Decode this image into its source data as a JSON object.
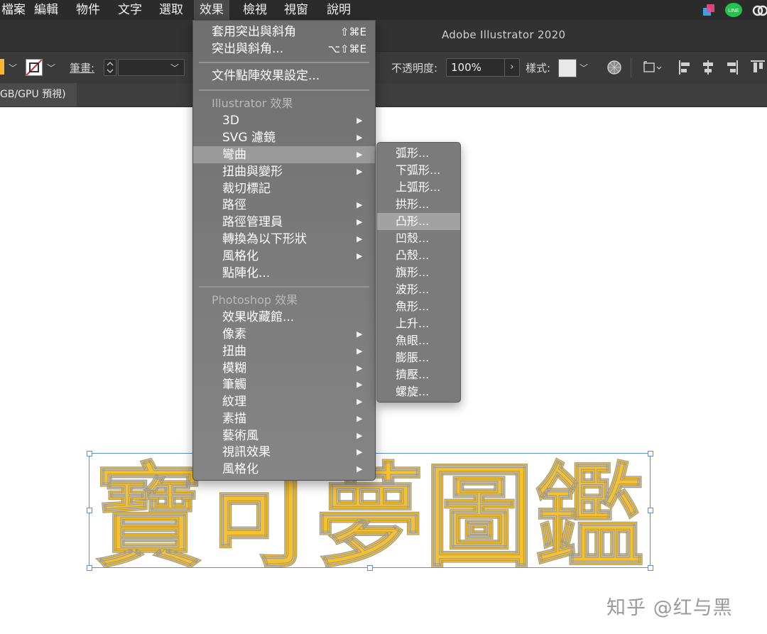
{
  "menubar": {
    "items": [
      "檔案",
      "編輯",
      "物件",
      "文字",
      "選取",
      "效果",
      "檢視",
      "視窗",
      "說明"
    ],
    "active": "效果"
  },
  "title": "Adobe Illustrator 2020",
  "controlbar": {
    "stroke_label": "筆畫:",
    "opacity_label": "不透明度:",
    "opacity_value": "100%",
    "style_label": "樣式:"
  },
  "tab": {
    "label": "GB/GPU 預視)"
  },
  "effect_menu": {
    "top_items": [
      {
        "label": "套用突出與斜角",
        "shortcut": "⇧⌘E"
      },
      {
        "label": "突出與斜角...",
        "shortcut": "⌥⇧⌘E"
      }
    ],
    "doc_raster": "文件點陣效果設定...",
    "illustrator_header": "Illustrator 效果",
    "illustrator_items": [
      {
        "label": "3D",
        "submenu": true
      },
      {
        "label": "SVG 濾鏡",
        "submenu": true
      },
      {
        "label": "彎曲",
        "submenu": true,
        "highlighted": true
      },
      {
        "label": "扭曲與變形",
        "submenu": true
      },
      {
        "label": "裁切標記",
        "submenu": false
      },
      {
        "label": "路徑",
        "submenu": true
      },
      {
        "label": "路徑管理員",
        "submenu": true
      },
      {
        "label": "轉換為以下形狀",
        "submenu": true
      },
      {
        "label": "風格化",
        "submenu": true
      },
      {
        "label": "點陣化...",
        "submenu": false
      }
    ],
    "photoshop_header": "Photoshop 效果",
    "photoshop_items": [
      {
        "label": "效果收藏館...",
        "submenu": false
      },
      {
        "label": "像素",
        "submenu": true
      },
      {
        "label": "扭曲",
        "submenu": true
      },
      {
        "label": "模糊",
        "submenu": true
      },
      {
        "label": "筆觸",
        "submenu": true
      },
      {
        "label": "紋理",
        "submenu": true
      },
      {
        "label": "素描",
        "submenu": true
      },
      {
        "label": "藝術風",
        "submenu": true
      },
      {
        "label": "視訊效果",
        "submenu": true
      },
      {
        "label": "風格化",
        "submenu": true
      }
    ]
  },
  "warp_menu": {
    "items": [
      "弧形...",
      "下弧形...",
      "上弧形...",
      "拱形...",
      "凸形...",
      "凹殼...",
      "凸殼...",
      "旗形...",
      "波形...",
      "魚形...",
      "上升...",
      "魚眼...",
      "膨脹...",
      "擠壓...",
      "螺旋..."
    ],
    "highlighted": "凸形..."
  },
  "artwork": {
    "text": "寶可夢圖鑑",
    "fill": "#f7c12b",
    "stroke": "#9b9b9b"
  },
  "watermark": "知乎 @红与黑",
  "colors": {
    "fill_swatch": "#f5b82e",
    "selection": "#5b8fd6"
  }
}
